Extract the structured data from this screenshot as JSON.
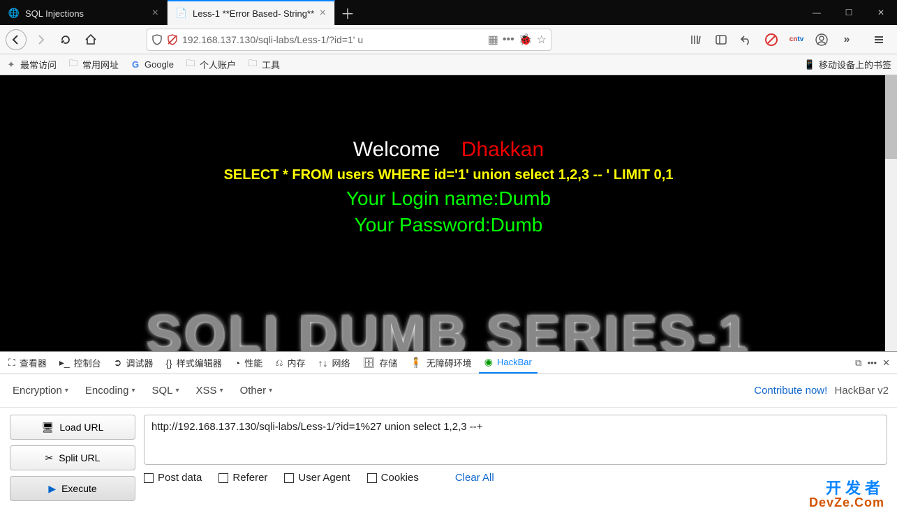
{
  "tabs": [
    {
      "title": "SQL Injections",
      "active": false
    },
    {
      "title": "Less-1 **Error Based- String**",
      "active": true
    }
  ],
  "url": "192.168.137.130/sqli-labs/Less-1/?id=1' u",
  "bookmarks": {
    "items": [
      {
        "label": "最常访问",
        "icon": "sparkle-icon"
      },
      {
        "label": "常用网址",
        "icon": "folder-icon"
      },
      {
        "label": "Google",
        "icon": "google-icon"
      },
      {
        "label": "个人账户",
        "icon": "folder-icon"
      },
      {
        "label": "工具",
        "icon": "folder-icon"
      }
    ],
    "mobile": "移动设备上的书签"
  },
  "page": {
    "welcome": "Welcome",
    "dhakkan": "Dhakkan",
    "sql": "SELECT * FROM users WHERE id='1' union select 1,2,3 -- ' LIMIT 0,1",
    "login": "Your Login name:Dumb",
    "password": "Your Password:Dumb",
    "series": "SQLI DUMB SERIES-1"
  },
  "devtools": {
    "tabs": [
      {
        "label": "查看器",
        "icon": "inspector-icon"
      },
      {
        "label": "控制台",
        "icon": "console-icon"
      },
      {
        "label": "调试器",
        "icon": "debugger-icon"
      },
      {
        "label": "样式编辑器",
        "icon": "style-icon"
      },
      {
        "label": "性能",
        "icon": "perf-icon"
      },
      {
        "label": "内存",
        "icon": "memory-icon"
      },
      {
        "label": "网络",
        "icon": "network-icon"
      },
      {
        "label": "存储",
        "icon": "storage-icon"
      },
      {
        "label": "无障碍环境",
        "icon": "a11y-icon"
      },
      {
        "label": "HackBar",
        "icon": "hackbar-icon",
        "active": true
      }
    ]
  },
  "hackbar": {
    "menus": [
      "Encryption",
      "Encoding",
      "SQL",
      "XSS",
      "Other"
    ],
    "contribute": "Contribute now!",
    "version": "HackBar v2",
    "buttons": {
      "load": "Load URL",
      "split": "Split URL",
      "execute": "Execute"
    },
    "url": "http://192.168.137.130/sqli-labs/Less-1/?id=1%27 union select 1,2,3 --+",
    "checks": [
      "Post data",
      "Referer",
      "User Agent",
      "Cookies"
    ],
    "clear": "Clear All"
  },
  "watermark": {
    "l1": "开发者",
    "l2": "DevZe.Com"
  }
}
